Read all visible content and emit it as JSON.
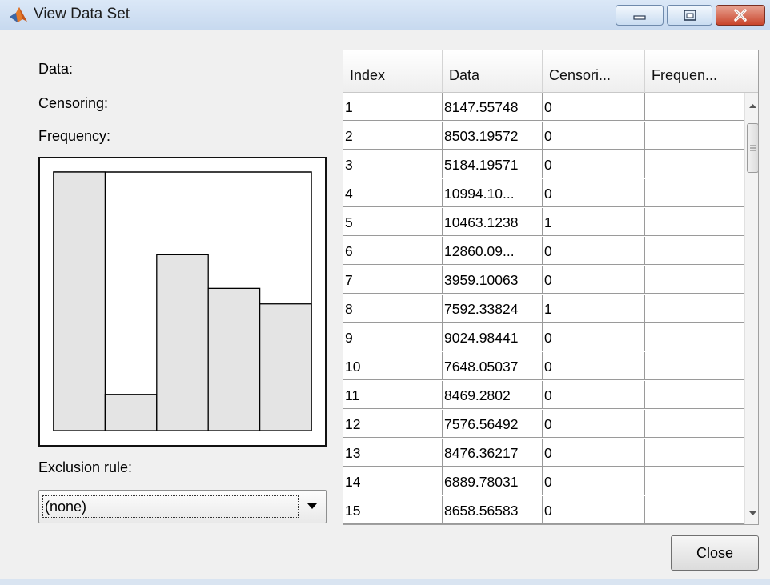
{
  "window": {
    "title": "View Data Set",
    "icon": "matlab-logo-icon",
    "controls": [
      "minimize-icon",
      "maximize-icon",
      "close-icon"
    ]
  },
  "left_panel": {
    "data_label": "Data:",
    "censoring_label": "Censoring:",
    "frequency_label": "Frequency:",
    "exclusion_label": "Exclusion rule:",
    "exclusion_value": "(none)"
  },
  "table": {
    "columns": [
      "Index",
      "Data",
      "Censori...",
      "Frequen..."
    ],
    "rows": [
      [
        "1",
        "8147.55748",
        "0",
        ""
      ],
      [
        "2",
        "8503.19572",
        "0",
        ""
      ],
      [
        "3",
        "5184.19571",
        "0",
        ""
      ],
      [
        "4",
        "10994.10...",
        "0",
        ""
      ],
      [
        "5",
        "10463.1238",
        "1",
        ""
      ],
      [
        "6",
        "12860.09...",
        "0",
        ""
      ],
      [
        "7",
        "3959.10063",
        "0",
        ""
      ],
      [
        "8",
        "7592.33824",
        "1",
        ""
      ],
      [
        "9",
        "9024.98441",
        "0",
        ""
      ],
      [
        "10",
        "7648.05037",
        "0",
        ""
      ],
      [
        "11",
        "8469.2802",
        "0",
        ""
      ],
      [
        "12",
        "7576.56492",
        "0",
        ""
      ],
      [
        "13",
        "8476.36217",
        "0",
        ""
      ],
      [
        "14",
        "6889.78031",
        "0",
        ""
      ],
      [
        "15",
        "8658.56583",
        "0",
        ""
      ]
    ]
  },
  "buttons": {
    "close_label": "Close"
  },
  "chart_data": {
    "type": "bar",
    "values": [
      1.0,
      0.14,
      0.68,
      0.55,
      0.49
    ],
    "colors": {
      "bar_fill": "#e4e4e4",
      "bar_stroke": "#000000"
    }
  }
}
